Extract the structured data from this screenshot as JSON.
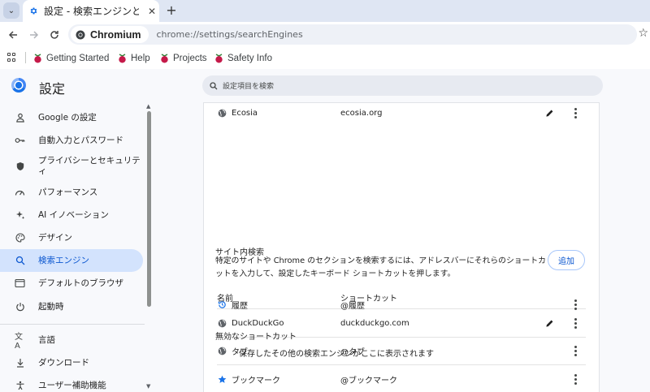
{
  "browser": {
    "tab": {
      "title": "設定 - 検索エンジンと サ"
    },
    "omnibox": {
      "chip_label": "Chromium",
      "url": "chrome://settings/searchEngines"
    },
    "bookmarks": [
      "Getting Started",
      "Help",
      "Projects",
      "Safety Info"
    ]
  },
  "settings": {
    "title": "設定",
    "search_placeholder": "設定項目を検索",
    "nav": [
      {
        "label": "Google の設定",
        "icon": "person-icon"
      },
      {
        "label": "自動入力とパスワード",
        "icon": "key-icon"
      },
      {
        "label": "プライバシーとセキュリティ",
        "icon": "shield-icon"
      },
      {
        "label": "パフォーマンス",
        "icon": "speedometer-icon"
      },
      {
        "label": "AI イノベーション",
        "icon": "sparkle-icon"
      },
      {
        "label": "デザイン",
        "icon": "palette-icon"
      },
      {
        "label": "検索エンジン",
        "icon": "search-icon",
        "active": true
      },
      {
        "label": "デフォルトのブラウザ",
        "icon": "browser-window-icon"
      },
      {
        "label": "起動時",
        "icon": "power-icon"
      },
      {
        "label": "言語",
        "icon": "translate-icon"
      },
      {
        "label": "ダウンロード",
        "icon": "download-icon"
      },
      {
        "label": "ユーザー補助機能",
        "icon": "accessibility-icon"
      }
    ]
  },
  "main": {
    "ecosia": {
      "name": "Ecosia",
      "shortcut": "ecosia.org"
    },
    "site_search": {
      "title": "サイト内検索",
      "description": "特定のサイトや Chrome のセクションを検索するには、アドレスバーにそれらのショートカットを入力して、設定したキーボード ショートカットを押します。",
      "add_label": "追加",
      "col_name": "名前",
      "col_shortcut": "ショートカット",
      "rows": [
        {
          "name": "DuckDuckGo",
          "shortcut": "duckduckgo.com",
          "icon": "globe-icon"
        },
        {
          "name": "タブ",
          "shortcut": "@タブ",
          "icon": "globe-icon"
        },
        {
          "name": "ブックマーク",
          "shortcut": "@ブックマーク",
          "icon": "star-icon"
        },
        {
          "name": "履歴",
          "shortcut": "@履歴",
          "icon": "history-icon"
        }
      ]
    },
    "inactive": {
      "title": "無効なショートカット",
      "empty_message": "保存したその他の検索エンジンがここに表示されます"
    }
  }
}
